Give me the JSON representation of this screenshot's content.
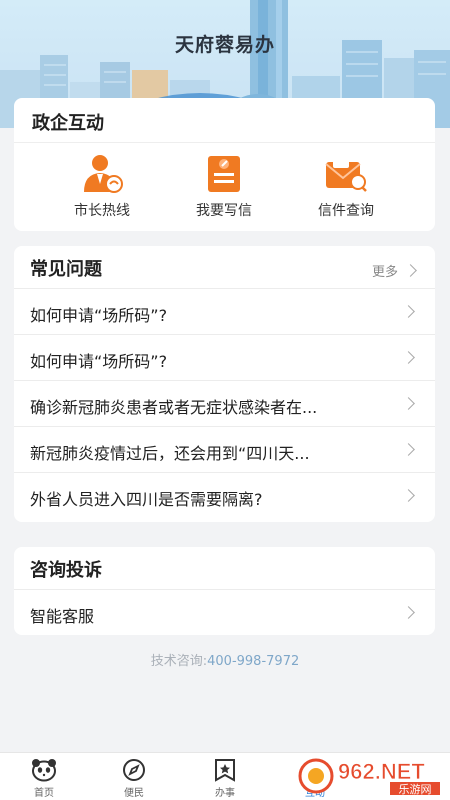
{
  "header": {
    "app_title": "天府蓉易办"
  },
  "interaction": {
    "title": "政企互动",
    "items": [
      {
        "label": "市长热线",
        "icon": "mayor-hotline-icon"
      },
      {
        "label": "我要写信",
        "icon": "write-letter-icon"
      },
      {
        "label": "信件查询",
        "icon": "letter-query-icon"
      }
    ]
  },
  "faq": {
    "title": "常见问题",
    "more_label": "更多",
    "items": [
      "如何申请“场所码”?",
      "如何申请“场所码”?",
      "确诊新冠肺炎患者或者无症状感染者在...",
      "新冠肺炎疫情过后，还会用到“四川天...",
      "外省人员进入四川是否需要隔离?"
    ]
  },
  "consult": {
    "title": "咨询投诉",
    "items": [
      "智能客服"
    ]
  },
  "support": {
    "label": "技术咨询:",
    "phone": "400-998-7972"
  },
  "tabbar": {
    "items": [
      {
        "label": "首页",
        "icon": "panda-home-icon"
      },
      {
        "label": "便民",
        "icon": "compass-icon"
      },
      {
        "label": "办事",
        "icon": "bookmark-star-icon"
      },
      {
        "label": "互动",
        "icon": "interaction-icon",
        "active": true
      }
    ]
  },
  "watermark": {
    "text": "962.NET",
    "subtext": "乐游网"
  },
  "colors": {
    "accent": "#2f7fd6",
    "icon_orange": "#f07a22"
  }
}
